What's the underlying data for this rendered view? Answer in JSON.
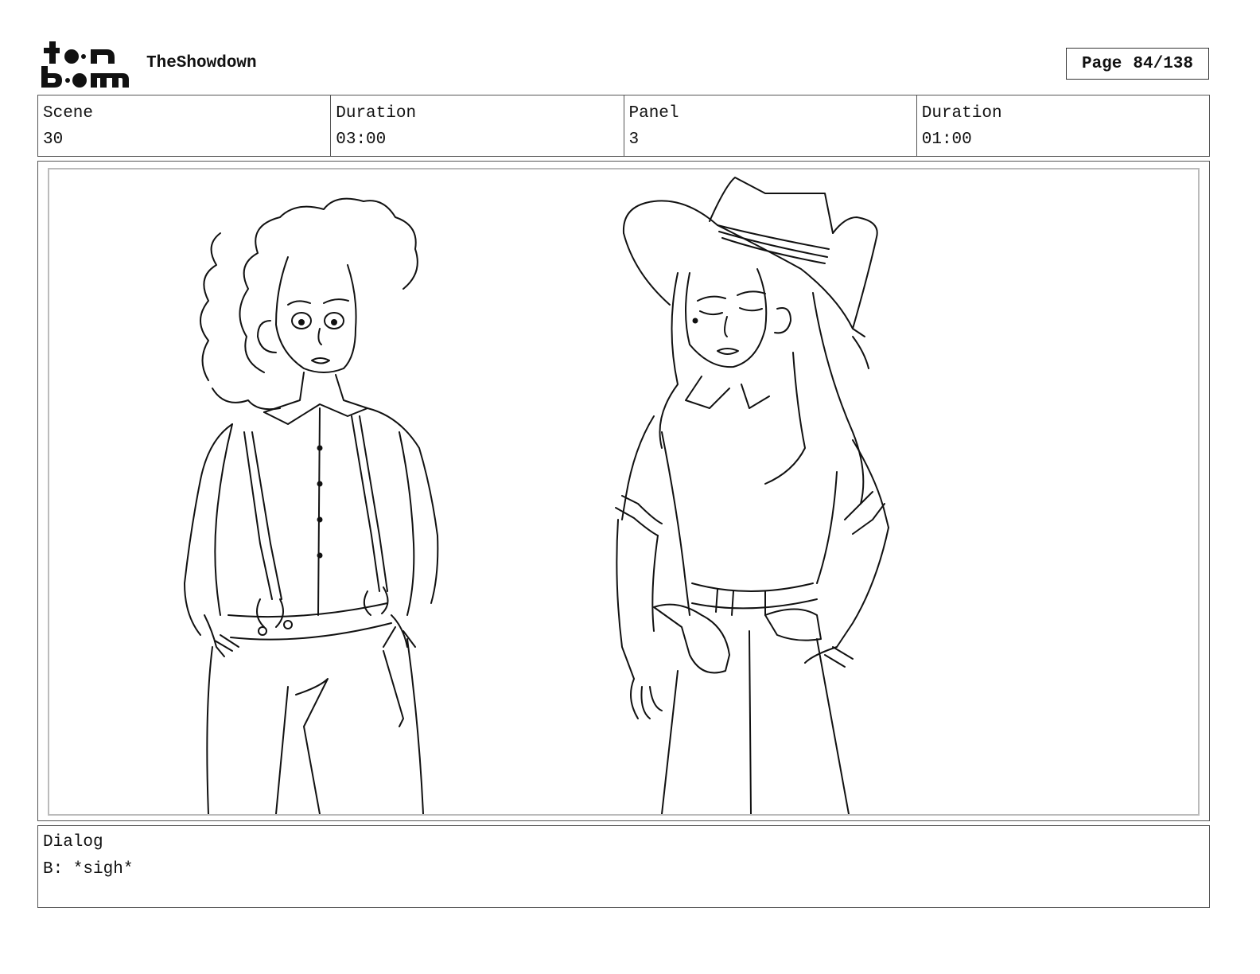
{
  "header": {
    "logo_icon": "toonboom-logo-icon",
    "project_title": "TheShowdown",
    "page_label": "Page",
    "page_number": "84/138"
  },
  "info": [
    {
      "label": "Scene",
      "value": "30"
    },
    {
      "label": "Duration",
      "value": "03:00"
    },
    {
      "label": "Panel",
      "value": "3"
    },
    {
      "label": "Duration",
      "value": "01:00"
    }
  ],
  "panel": {
    "image_icon": "storyboard-sketch-two-women-western"
  },
  "dialog": {
    "label": "Dialog",
    "text": "B: *sigh*"
  }
}
